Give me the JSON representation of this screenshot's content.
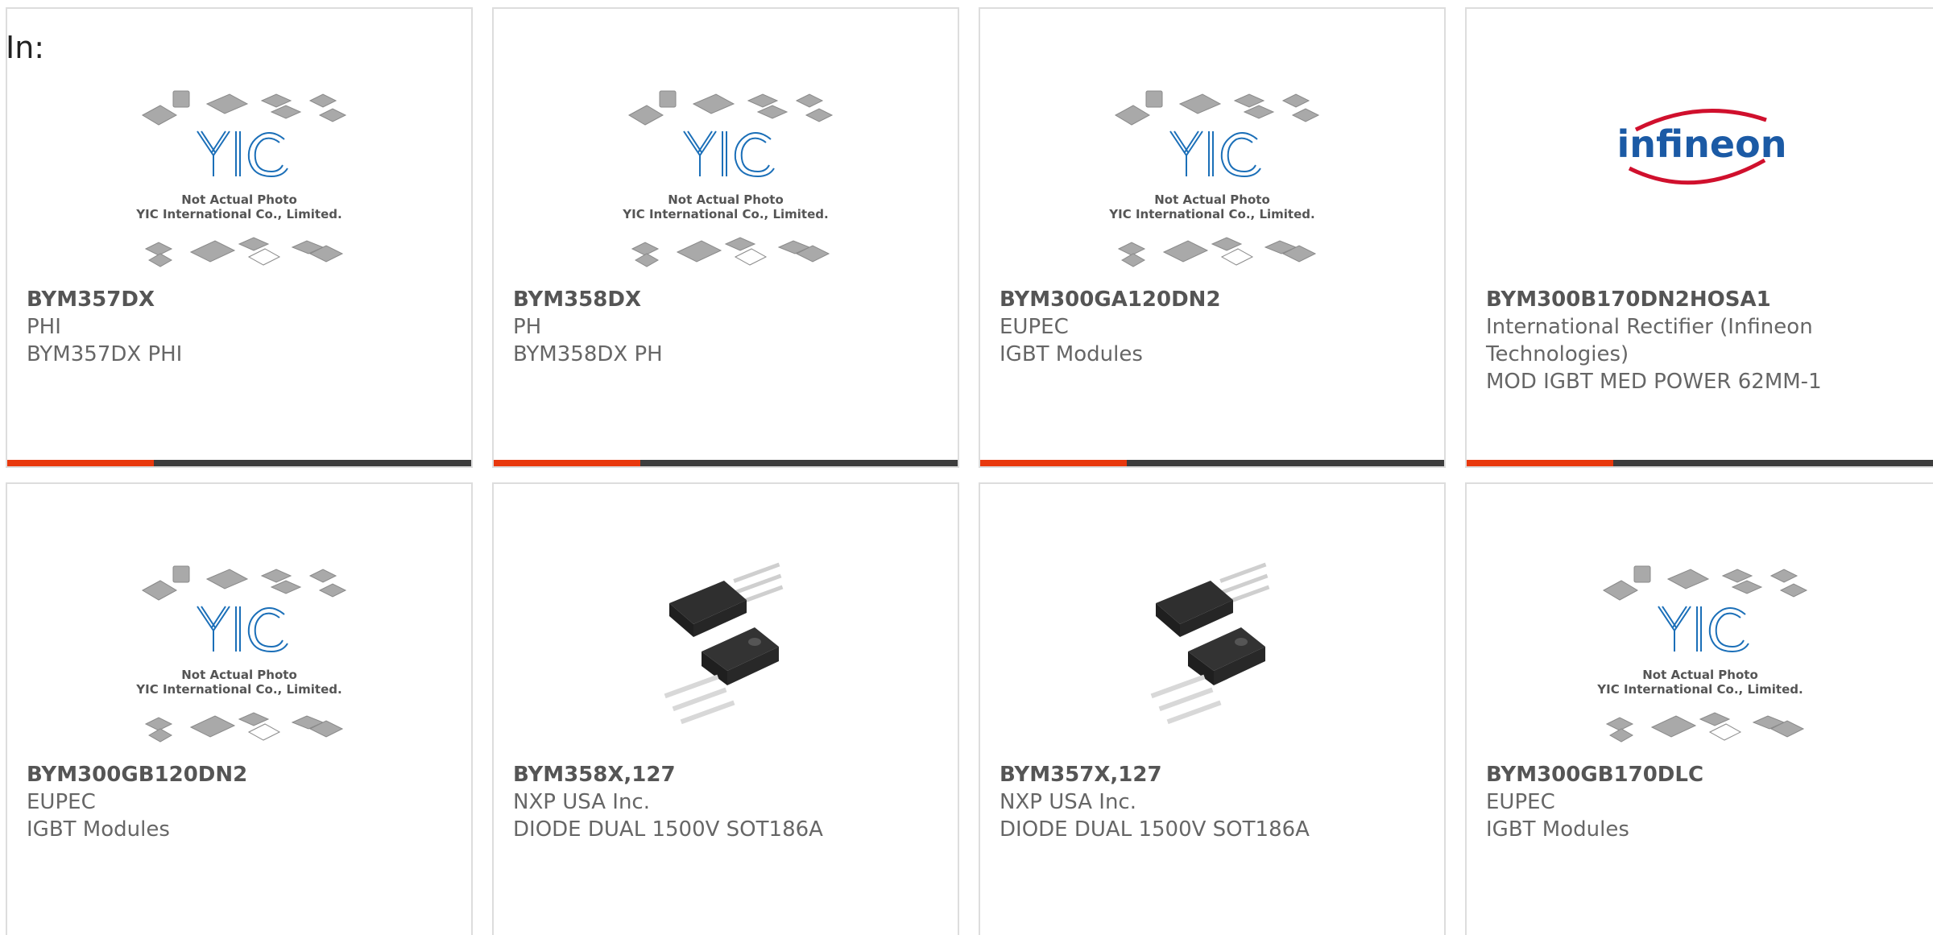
{
  "filter": {
    "label": "In:"
  },
  "placeholder_photo": {
    "line1": "Not Actual Photo",
    "line2": "YIC International Co., Limited.",
    "logo": "YIC"
  },
  "brand_logo": {
    "text": "infineon"
  },
  "products": [
    {
      "part": "BYM357DX",
      "manufacturer": "PHI",
      "description": "BYM357DX PHI",
      "image": "placeholder"
    },
    {
      "part": "BYM358DX",
      "manufacturer": "PH",
      "description": "BYM358DX PH",
      "image": "placeholder"
    },
    {
      "part": "BYM300GA120DN2",
      "manufacturer": "EUPEC",
      "description": "IGBT Modules",
      "image": "placeholder"
    },
    {
      "part": "BYM300B170DN2HOSA1",
      "manufacturer": "International Rectifier (Infineon Technologies)",
      "description": "MOD IGBT MED POWER 62MM-1",
      "image": "infineon-logo"
    },
    {
      "part": "BYM300GB120DN2",
      "manufacturer": "EUPEC",
      "description": "IGBT Modules",
      "image": "placeholder"
    },
    {
      "part": "BYM358X,127",
      "manufacturer": "NXP USA Inc.",
      "description": "DIODE DUAL 1500V SOT186A",
      "image": "to220-photo"
    },
    {
      "part": "BYM357X,127",
      "manufacturer": "NXP USA Inc.",
      "description": "DIODE DUAL 1500V SOT186A",
      "image": "to220-photo"
    },
    {
      "part": "BYM300GB170DLC",
      "manufacturer": "EUPEC",
      "description": "IGBT Modules",
      "image": "placeholder"
    }
  ],
  "colors": {
    "accent": "#e8380d",
    "bar": "#3d3d3d",
    "yic_blue": "#1b6fb8",
    "infineon_blue": "#1b5aa5",
    "infineon_red": "#d0102d"
  }
}
